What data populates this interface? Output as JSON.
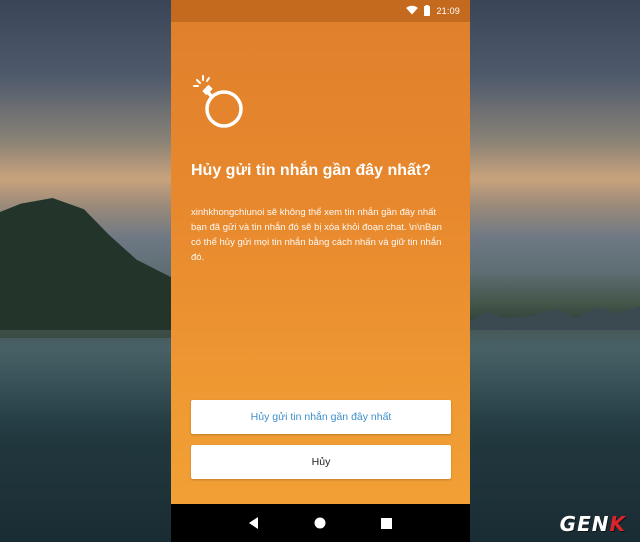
{
  "status_bar": {
    "time": "21:09",
    "icons": [
      "wifi-icon",
      "battery-icon"
    ]
  },
  "dialog": {
    "icon": "bomb-icon",
    "title": "Hủy gửi tin nhắn gần đây nhất?",
    "description": "xinhkhongchiunoi sẽ không thể xem tin nhắn gần đây nhất bạn đã gửi và tin nhắn đó sẽ bị xóa khỏi đoạn chat. \\n\\nBạn có thể hủy gửi mọi tin nhắn bằng cách nhấn và giữ tin nhắn đó.",
    "primary_label": "Hủy gửi tin nhắn gần đây nhất",
    "cancel_label": "Hủy"
  },
  "nav_bar": {
    "icons": [
      "back-icon",
      "home-icon",
      "recents-icon"
    ]
  },
  "watermark": {
    "prefix": "GEN",
    "suffix": "K"
  },
  "colors": {
    "phone_bg": "#e8892e",
    "status_bar": "#c46a1f",
    "primary_text": "#3d8fc9"
  }
}
